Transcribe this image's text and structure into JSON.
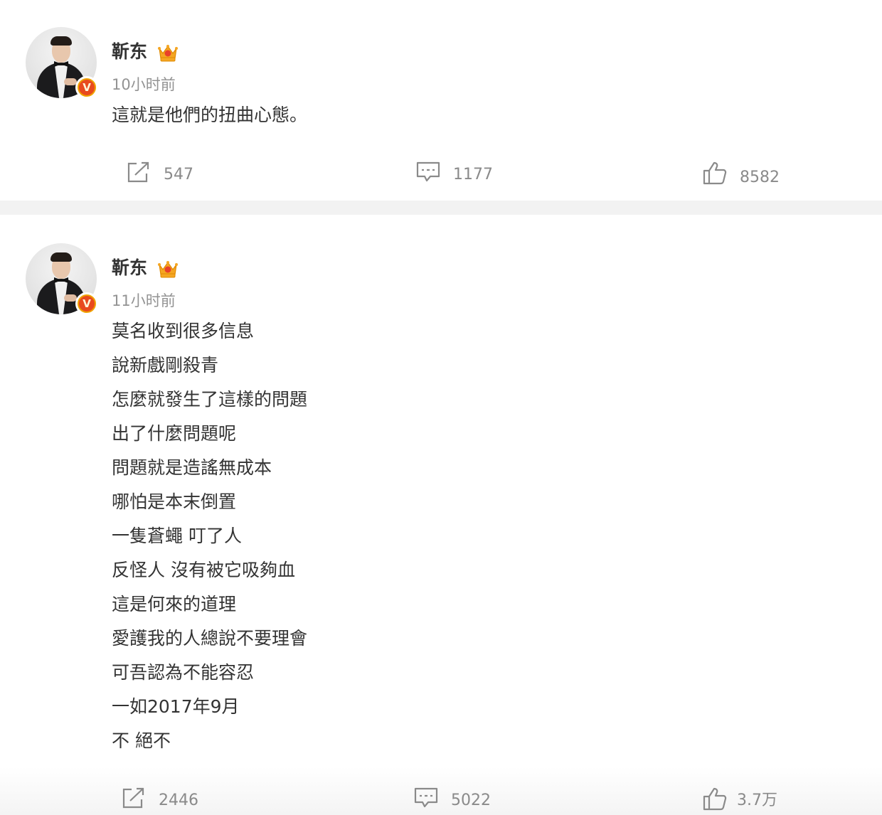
{
  "posts": [
    {
      "author": "靳东",
      "verified_badge": "V",
      "time": "10小时前",
      "lines": [
        "這就是他們的扭曲心態。"
      ],
      "repost_count": "547",
      "comment_count": "1177",
      "like_count": "8582"
    },
    {
      "author": "靳东",
      "verified_badge": "V",
      "time": "11小时前",
      "lines": [
        "莫名收到很多信息",
        "說新戲剛殺青",
        "怎麼就發生了這樣的問題",
        "出了什麼問題呢",
        "問題就是造謠無成本",
        "哪怕是本末倒置",
        "一隻蒼蠅 叮了人",
        "反怪人 沒有被它吸夠血",
        "這是何來的道理",
        "愛護我的人總說不要理會",
        "可吾認為不能容忍",
        "一如2017年9月",
        "不 絕不"
      ],
      "repost_count": "2446",
      "comment_count": "5022",
      "like_count": "3.7万"
    }
  ],
  "icons": {
    "crown": "crown-icon",
    "verified": "verified-v-icon",
    "repost": "share-icon",
    "comment": "comment-icon",
    "like": "thumbs-up-icon"
  },
  "colors": {
    "text": "#333333",
    "muted": "#939393",
    "counts": "#8a8a8a",
    "badge_ring": "#f0a200",
    "badge_fill": "#e84a1e",
    "crown": "#f5a623",
    "divider": "#f2f2f2"
  }
}
